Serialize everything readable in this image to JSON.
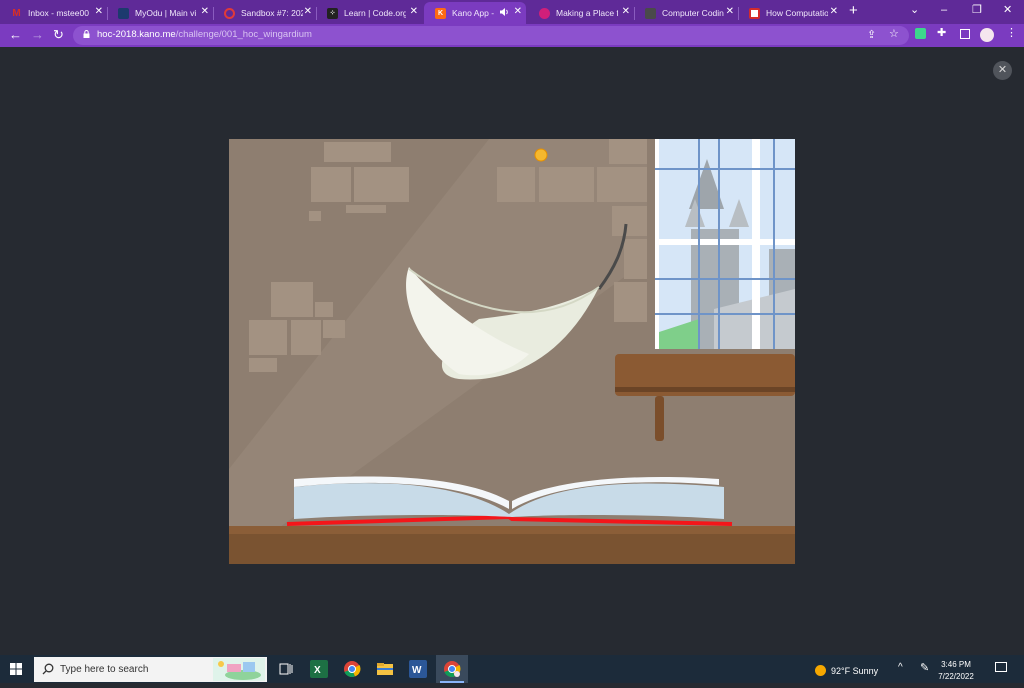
{
  "browser": {
    "tabs": [
      {
        "title": "Inbox - mstee00",
        "icon": "gmail-icon",
        "color": "#d93025"
      },
      {
        "title": "MyOdu | Main vi",
        "icon": "odu-icon",
        "color": "#1d3a6e"
      },
      {
        "title": "Sandbox #7: 202",
        "icon": "sandbox-icon",
        "color": "#e03a3a"
      },
      {
        "title": "Learn | Code.org",
        "icon": "codeorg-icon",
        "color": "#222222"
      },
      {
        "title": "Kano App -",
        "icon": "kano-icon",
        "color": "#ff6a13",
        "active": true,
        "audio": true
      },
      {
        "title": "Making a Place f",
        "icon": "place-icon",
        "color": "#d01f7a"
      },
      {
        "title": "Computer Codin",
        "icon": "codin-icon",
        "color": "#555555"
      },
      {
        "title": "How Computatio",
        "icon": "how-icon",
        "color": "#d42b2b"
      }
    ],
    "new_tab": "+",
    "url": {
      "domain": "hoc-2018.kano.me",
      "path": "/challenge/001_hoc_wingardium"
    },
    "window_controls": {
      "chevron": "⌄",
      "minimize": "–",
      "restore": "❐",
      "close": "✕"
    }
  },
  "page": {
    "close_label": "✕",
    "scene": {
      "description_icon": "feather-book-scene"
    }
  },
  "taskbar": {
    "search_placeholder": "Type here to search",
    "weather": "92°F  Sunny",
    "time": "3:46 PM",
    "date": "7/22/2022",
    "apps": [
      "task-view-icon",
      "excel-icon",
      "chrome-icon",
      "file-explorer-icon",
      "word-icon",
      "chrome-profile-icon"
    ]
  },
  "colors": {
    "tab_strip": "#5f2a98",
    "toolbar": "#7b3bc0",
    "page_bg": "#262a31",
    "taskbar": "#1c2b3a"
  }
}
